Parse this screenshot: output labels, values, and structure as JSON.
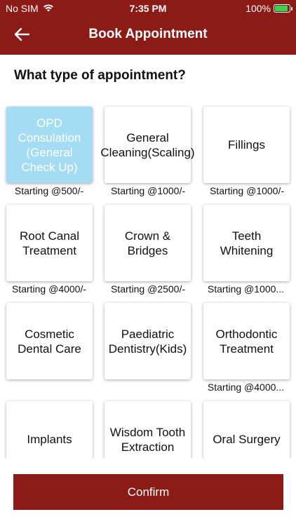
{
  "status_bar": {
    "carrier": "No SIM",
    "time": "7:35 PM",
    "battery": "100%"
  },
  "header": {
    "title": "Book Appointment"
  },
  "question": "What type of appointment?",
  "services": [
    {
      "name": "OPD Consulation (General Check Up)",
      "price": "Starting @500/-",
      "selected": true
    },
    {
      "name": "General Cleaning(Scaling)",
      "price": "Starting @1000/-"
    },
    {
      "name": "Fillings",
      "price": "Starting @1000/-"
    },
    {
      "name": "Root Canal Treatment",
      "price": "Starting @4000/-"
    },
    {
      "name": "Crown & Bridges",
      "price": "Starting @2500/-"
    },
    {
      "name": "Teeth Whitening",
      "price": "Starting @1000..."
    },
    {
      "name": "Cosmetic Dental Care",
      "price": ""
    },
    {
      "name": "Paediatric Dentistry(Kids)",
      "price": ""
    },
    {
      "name": "Orthodontic Treatment",
      "price": "Starting @4000..."
    },
    {
      "name": "Implants",
      "price": ""
    },
    {
      "name": "Wisdom Tooth Extraction",
      "price": ""
    },
    {
      "name": "Oral Surgery",
      "price": ""
    }
  ],
  "confirm_label": "Confirm",
  "colors": {
    "brand": "#8c1a17",
    "selected_card": "#a3dcf3"
  }
}
